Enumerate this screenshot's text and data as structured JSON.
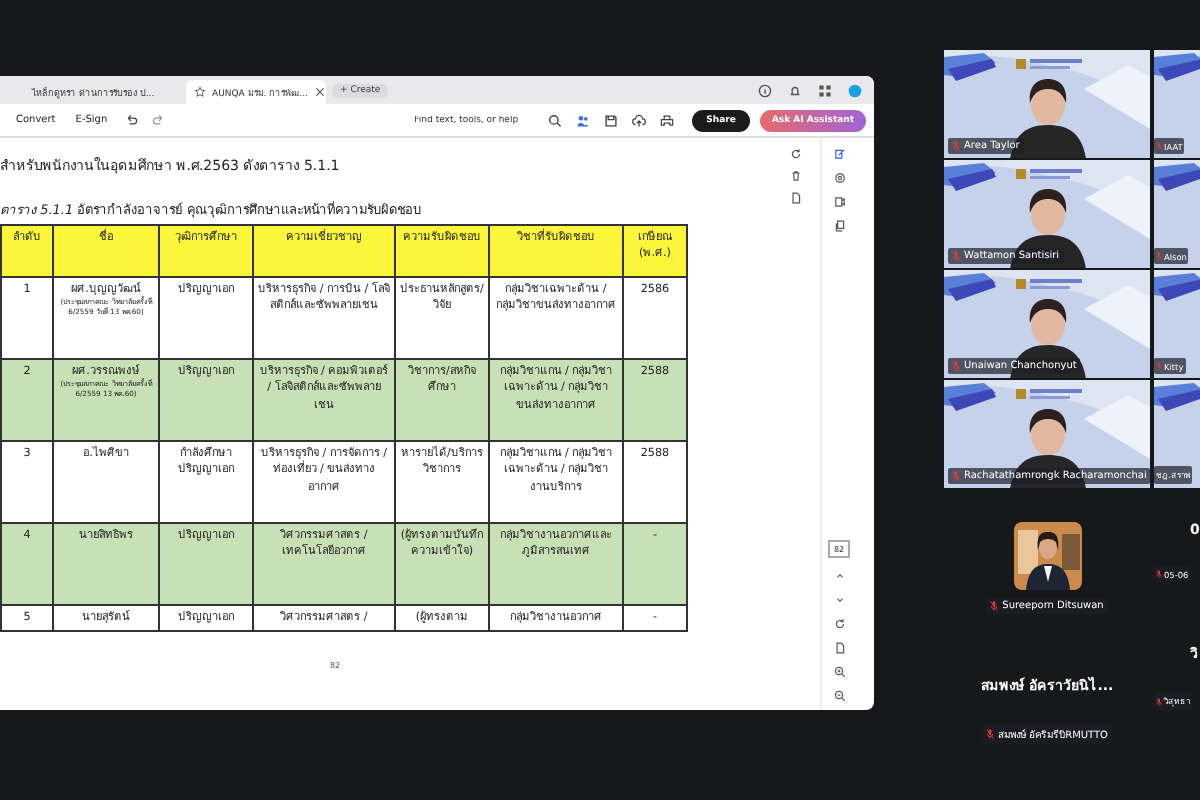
{
  "browser": {
    "tabs": [
      {
        "label": "ไหล็กดูทรา ด่านการรับรอง ป...",
        "selected": false
      },
      {
        "label": "AUNQA มรม. การพัฒ...",
        "selected": true
      }
    ],
    "new_tab": "+ Create",
    "toolbar": {
      "items": [
        "Convert",
        "E-Sign"
      ],
      "search": {
        "placeholder": "Find text, tools, or help"
      },
      "share": "Share",
      "ai_button": "Ask AI Assistant"
    }
  },
  "document": {
    "intro": "สำหรับพนักงานในอุดมศึกษา พ.ศ.2563 ดังตาราง 5.1.1",
    "caption": "*ตาราง 5.1.1* อัตรากำลังอาจารย์ คุณวุฒิการศึกษาและหน้าที่ความรับผิดชอบ",
    "table": {
      "columns": [
        "ลำดับ",
        "ชื่อ",
        "วุฒิการศึกษา",
        "ความเชี่ยวชาญ",
        "ความรับผิดชอบ",
        "วิชาที่รับผิดชอบ",
        "เกษียณ (พ.ศ.)"
      ],
      "rows": [
        {
          "shaded": false,
          "note": "(ประชุมสภาคณะ วิทยาลัยครั้งที่ 6/2559 วันที่ 13 พค.60)",
          "cells": [
            "1",
            "ผศ.บุญญวัฒน์",
            "ปริญญาเอก",
            "บริหารธุรกิจ / การบิน / โลจิสติกส์และซัพพลายเชน",
            "ประธานหลักสูตร/วิจัย",
            "กลุ่มวิชาเฉพาะด้าน / กลุ่มวิชาขนส่งทางอากาศ",
            "2586"
          ]
        },
        {
          "shaded": true,
          "note": "(ประชุมสภาคณะ วิทยาลัยครั้งที่ 6/2559 13 พค.60)",
          "cells": [
            "2",
            "ผศ.วรรณพงษ์",
            "ปริญญาเอก",
            "บริหารธุรกิจ / คอมพิวเตอร์ / โลจิสติกส์และซัพพลายเชน",
            "วิชาการ/สหกิจศึกษา",
            "กลุ่มวิชาแกน / กลุ่มวิชาเฉพาะด้าน / กลุ่มวิชาขนส่งทางอากาศ",
            "2588"
          ]
        },
        {
          "shaded": false,
          "cells": [
            "3",
            "อ.ไพศิขา",
            "กำลังศึกษาปริญญาเอก",
            "บริหารธุรกิจ / การจัดการ / ท่องเที่ยว / ขนส่งทางอากาศ",
            "หารายได้/บริการวิชาการ",
            "กลุ่มวิชาแกน / กลุ่มวิชาเฉพาะด้าน / กลุ่มวิชางานบริการ",
            "2588"
          ]
        },
        {
          "shaded": true,
          "cells": [
            "4",
            "นายสิทธิพร",
            "ปริญญาเอก",
            "วิศวกรรมศาสตร / เทคโนโลยีอวกาศ",
            "(ผู้ทรงตามบันทึกความเข้าใจ)",
            "กลุ่มวิชางานอวกาศและภูมิสารสนเทศ",
            "-"
          ]
        },
        {
          "shaded": false,
          "cells": [
            "5",
            "นายสุรัตน์",
            "ปริญญาเอก",
            "วิศวกรรมศาสตร /",
            "(ผู้ทรงตาม",
            "กลุ่มวิชางานอวกาศ",
            "-"
          ]
        }
      ]
    },
    "page_number": "82"
  },
  "page_nav": {
    "current": "82"
  },
  "gallery": [
    {
      "tiles": [
        {
          "kind": "video",
          "name": "Area Taylor",
          "muted": true
        },
        {
          "kind": "video",
          "name": "Wattamon Santisiri",
          "muted": true
        },
        {
          "kind": "video",
          "name": "Unaiwan Chanchonyut",
          "muted": true
        },
        {
          "kind": "video",
          "name": "Rachatathamrongk Racharamonchai",
          "muted": true
        },
        {
          "kind": "avatar",
          "name": "Sureeporn Ditsuwan",
          "muted": true
        },
        {
          "kind": "initials",
          "display": "สมพงษ์ อัคราวัยนิไ...",
          "name": "สมพงษ์ อัคริมรีบิRMUTTO",
          "muted": true
        }
      ]
    },
    {
      "tiles": [
        {
          "kind": "video",
          "name": "IAAT",
          "muted": true
        },
        {
          "kind": "video",
          "name": "Alson",
          "muted": true
        },
        {
          "kind": "video",
          "name": "Kitty",
          "muted": true
        },
        {
          "kind": "video",
          "name": "ชฎ.สราพ",
          "muted": false
        },
        {
          "kind": "initials",
          "display": "0",
          "name": "05-06",
          "muted": true
        },
        {
          "kind": "initials",
          "display": "วิ",
          "name": "วิสุทธา",
          "muted": true
        }
      ]
    }
  ]
}
